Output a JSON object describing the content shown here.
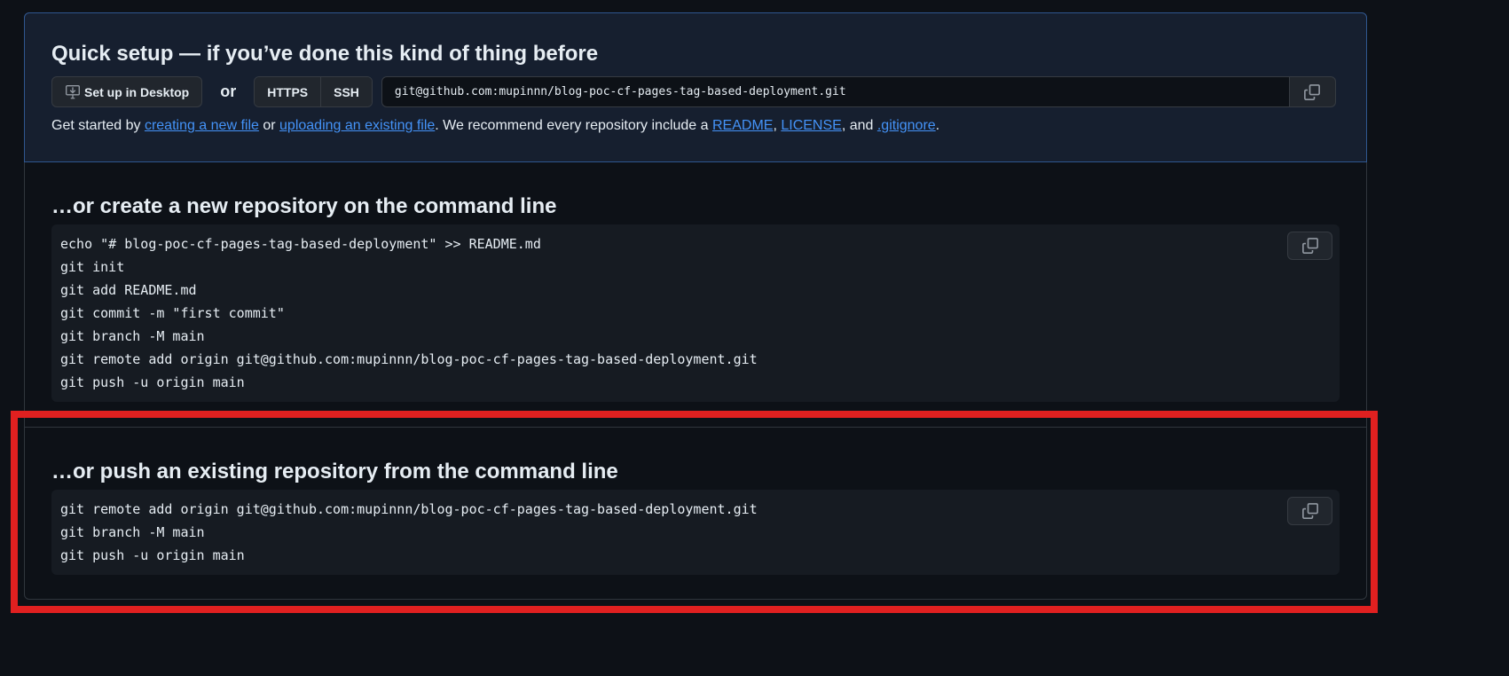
{
  "quick_setup": {
    "title": "Quick setup — if you’ve done this kind of thing before",
    "desktop_button": "Set up in Desktop",
    "or": "or",
    "protocols": [
      "HTTPS",
      "SSH"
    ],
    "clone_url": "git@github.com:mupinnn/blog-poc-cf-pages-tag-based-deployment.git",
    "desc": {
      "p1": "Get started by ",
      "link1": "creating a new file",
      "p2": " or ",
      "link2": "uploading an existing file",
      "p3": ". We recommend every repository include a ",
      "link3": "README",
      "p4": ", ",
      "link4": "LICENSE",
      "p5": ", and ",
      "link5": ".gitignore",
      "p6": "."
    }
  },
  "new_repo": {
    "title": "…or create a new repository on the command line",
    "lines": [
      "echo \"# blog-poc-cf-pages-tag-based-deployment\" >> README.md",
      "git init",
      "git add README.md",
      "git commit -m \"first commit\"",
      "git branch -M main",
      "git remote add origin git@github.com:mupinnn/blog-poc-cf-pages-tag-based-deployment.git",
      "git push -u origin main"
    ]
  },
  "existing_repo": {
    "title": "…or push an existing repository from the command line",
    "lines": [
      "git remote add origin git@github.com:mupinnn/blog-poc-cf-pages-tag-based-deployment.git",
      "git branch -M main",
      "git push -u origin main"
    ]
  },
  "colors": {
    "link": "#4493f8",
    "annotation": "#e02020"
  }
}
